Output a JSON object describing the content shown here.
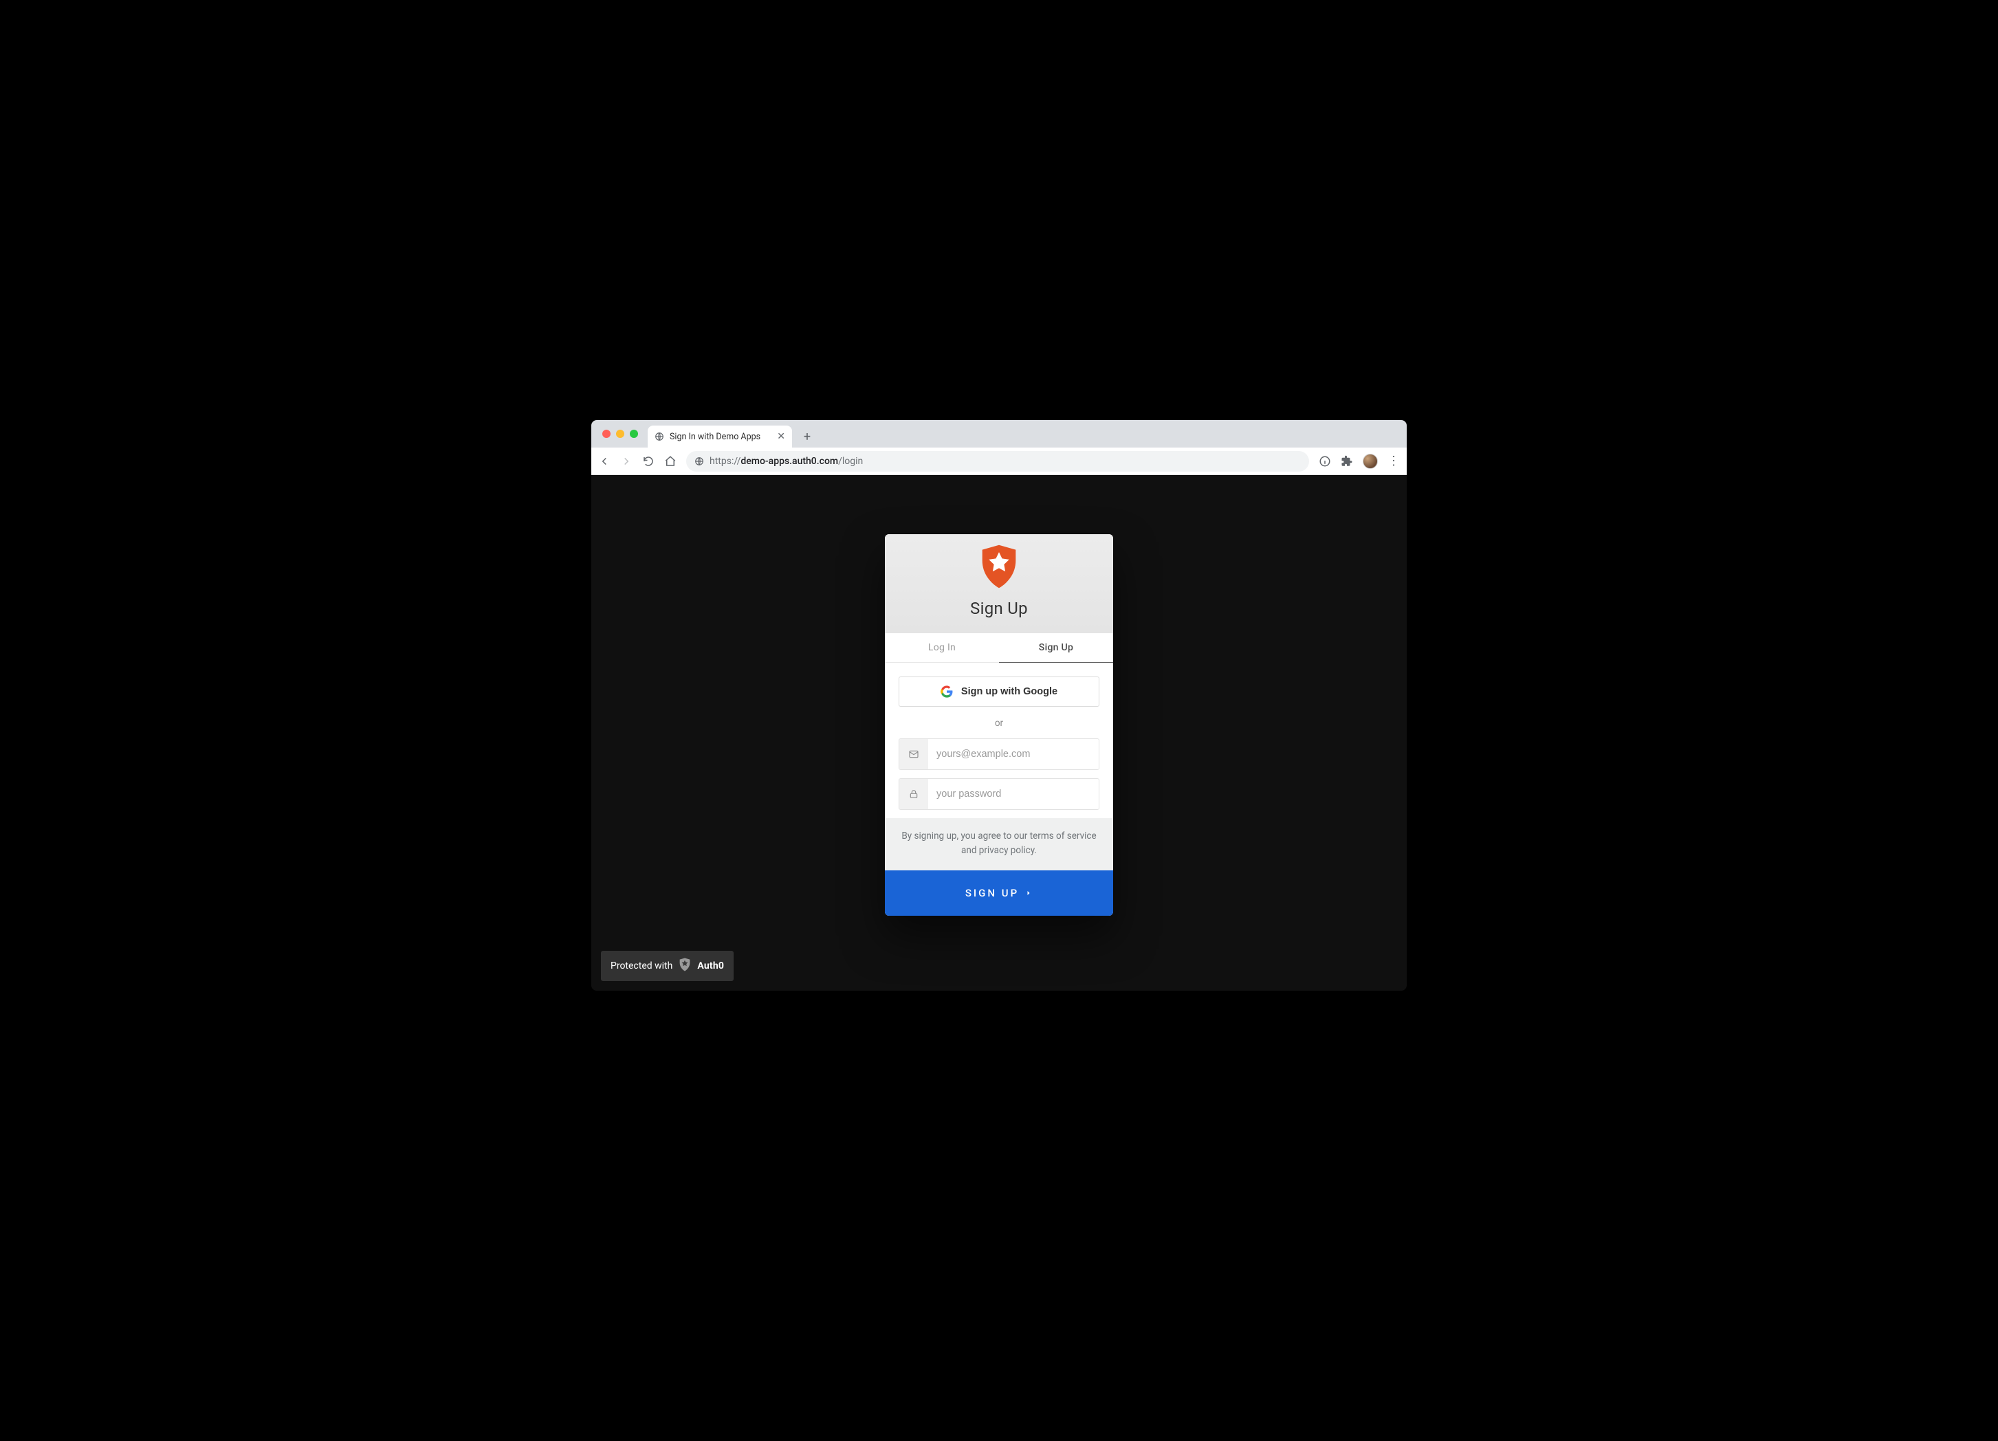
{
  "browser": {
    "tab_title": "Sign In with Demo Apps",
    "url_scheme": "https://",
    "url_host": "demo-apps.auth0.com",
    "url_path": "/login"
  },
  "lock": {
    "title": "Sign Up",
    "tabs": {
      "login": "Log In",
      "signup": "Sign Up",
      "active": "signup"
    },
    "social": {
      "google_label": "Sign up with Google"
    },
    "divider": "or",
    "email_placeholder": "yours@example.com",
    "password_placeholder": "your password",
    "terms": "By signing up, you agree to our terms of service and privacy policy.",
    "submit": "SIGN UP"
  },
  "footer": {
    "prefix": "Protected with",
    "brand": "Auth0"
  },
  "colors": {
    "accent_orange": "#e45424",
    "primary_blue": "#1a64d6"
  }
}
